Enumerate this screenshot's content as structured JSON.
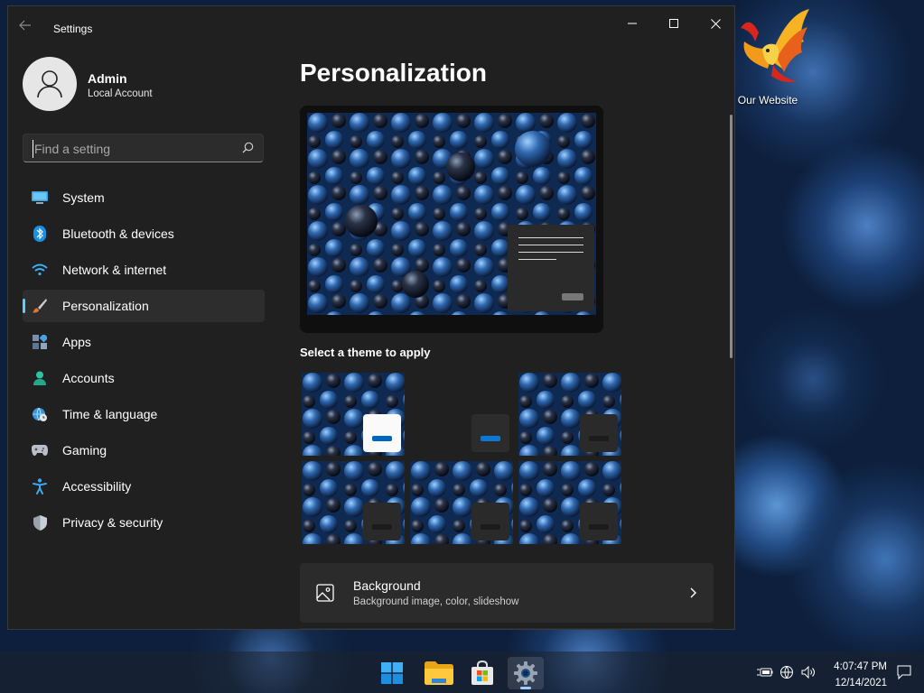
{
  "window": {
    "title": "Settings",
    "minimize_glyph": "—",
    "maximize_glyph": "☐",
    "close_glyph": "✕"
  },
  "profile": {
    "name": "Admin",
    "account_type": "Local Account"
  },
  "search": {
    "placeholder": "Find a setting",
    "value": ""
  },
  "nav": {
    "items": [
      {
        "label": "System",
        "icon": "monitor-icon",
        "active": false
      },
      {
        "label": "Bluetooth & devices",
        "icon": "bluetooth-icon",
        "active": false
      },
      {
        "label": "Network & internet",
        "icon": "wifi-icon",
        "active": false
      },
      {
        "label": "Personalization",
        "icon": "paintbrush-icon",
        "active": true
      },
      {
        "label": "Apps",
        "icon": "apps-icon",
        "active": false
      },
      {
        "label": "Accounts",
        "icon": "person-icon",
        "active": false
      },
      {
        "label": "Time & language",
        "icon": "globe-clock-icon",
        "active": false
      },
      {
        "label": "Gaming",
        "icon": "gamepad-icon",
        "active": false
      },
      {
        "label": "Accessibility",
        "icon": "accessibility-icon",
        "active": false
      },
      {
        "label": "Privacy & security",
        "icon": "shield-icon",
        "active": false
      }
    ]
  },
  "main": {
    "page_title": "Personalization",
    "themes_label": "Select a theme to apply",
    "themes": [
      {
        "name": "theme-1",
        "style": "bubbles-light"
      },
      {
        "name": "theme-2",
        "style": "dark-plain"
      },
      {
        "name": "theme-3",
        "style": "bubbles-dark"
      },
      {
        "name": "theme-4",
        "style": "bubbles-dark"
      },
      {
        "name": "theme-5",
        "style": "bubbles-dark"
      },
      {
        "name": "theme-6",
        "style": "bubbles-dark"
      }
    ],
    "background_card": {
      "title": "Background",
      "subtitle": "Background image, color, slideshow"
    }
  },
  "desktop": {
    "icon_label": "Our Website"
  },
  "taskbar": {
    "apps": [
      {
        "name": "start",
        "icon": "windows-logo-icon"
      },
      {
        "name": "file-explorer",
        "icon": "folder-icon"
      },
      {
        "name": "microsoft-store",
        "icon": "store-bag-icon"
      },
      {
        "name": "settings",
        "icon": "gear-icon",
        "active": true
      }
    ],
    "time": "4:07:47 PM",
    "date": "12/14/2021"
  },
  "colors": {
    "accent": "#60cdff",
    "window_bg": "#202020",
    "card_bg": "#2b2b2b",
    "theme_accent": "#0067c0"
  }
}
